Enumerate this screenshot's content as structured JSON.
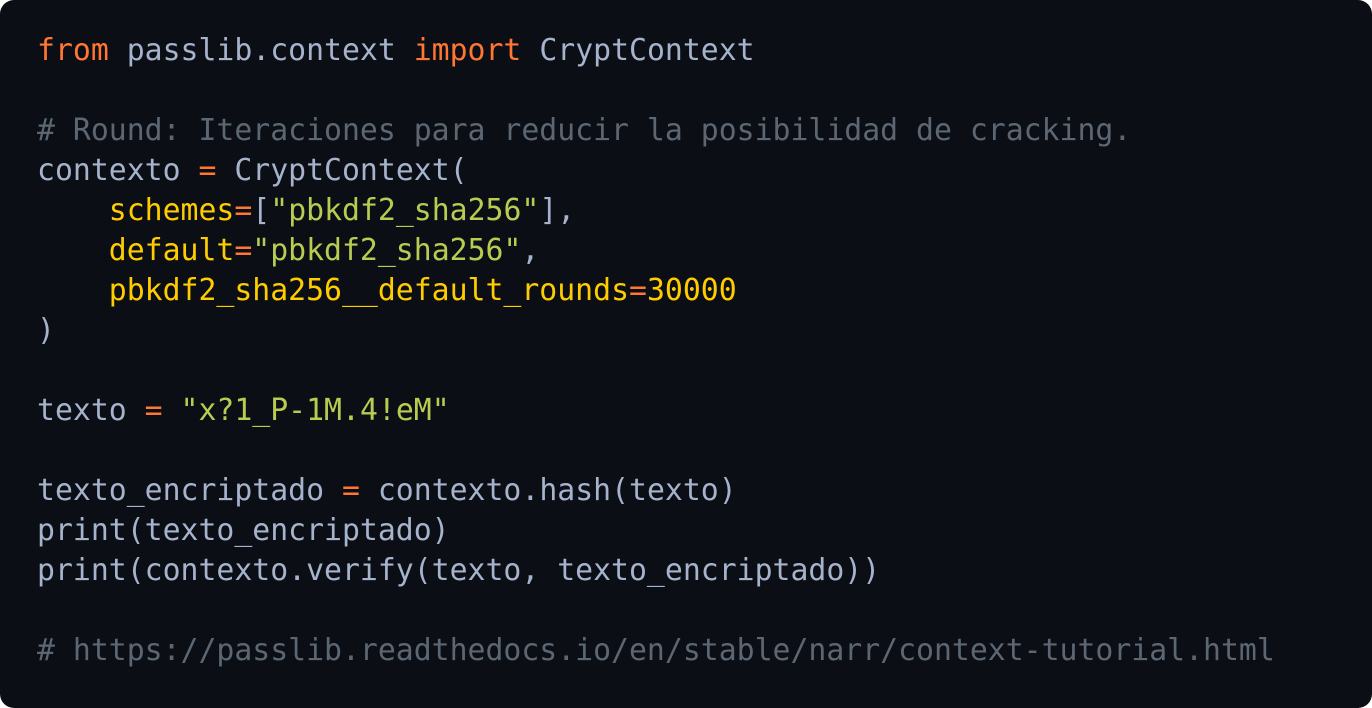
{
  "colors": {
    "background": "#0b0e14",
    "keyword": "#ff7733",
    "identifier": "#a6b3cc",
    "comment": "#5c6773",
    "parameter": "#ffcc00",
    "string": "#b8cc52"
  },
  "code": {
    "language": "python",
    "lines": [
      [
        [
          "kw",
          "from"
        ],
        [
          "id",
          " passlib.context "
        ],
        [
          "kw",
          "import"
        ],
        [
          "id",
          " CryptContext"
        ]
      ],
      [],
      [
        [
          "cm",
          "# Round: Iteraciones para reducir la posibilidad de cracking."
        ]
      ],
      [
        [
          "id",
          "contexto "
        ],
        [
          "op",
          "="
        ],
        [
          "id",
          " CryptContext("
        ]
      ],
      [
        [
          "id",
          "    "
        ],
        [
          "param",
          "schemes"
        ],
        [
          "op",
          "="
        ],
        [
          "id",
          "["
        ],
        [
          "str",
          "\"pbkdf2_sha256\""
        ],
        [
          "id",
          "],"
        ]
      ],
      [
        [
          "id",
          "    "
        ],
        [
          "param",
          "default"
        ],
        [
          "op",
          "="
        ],
        [
          "str",
          "\"pbkdf2_sha256\""
        ],
        [
          "id",
          ","
        ]
      ],
      [
        [
          "id",
          "    "
        ],
        [
          "param",
          "pbkdf2_sha256__default_rounds"
        ],
        [
          "op",
          "="
        ],
        [
          "num",
          "30000"
        ]
      ],
      [
        [
          "id",
          ")"
        ]
      ],
      [],
      [
        [
          "id",
          "texto "
        ],
        [
          "op",
          "="
        ],
        [
          "id",
          " "
        ],
        [
          "str",
          "\"x?1_P-1M.4!eM\""
        ]
      ],
      [],
      [
        [
          "id",
          "texto_encriptado "
        ],
        [
          "op",
          "="
        ],
        [
          "id",
          " contexto.hash(texto)"
        ]
      ],
      [
        [
          "id",
          "print(texto_encriptado)"
        ]
      ],
      [
        [
          "id",
          "print(contexto.verify(texto, texto_encriptado))"
        ]
      ],
      [],
      [
        [
          "cm",
          "# https://passlib.readthedocs.io/en/stable/narr/context-tutorial.html"
        ]
      ]
    ]
  }
}
